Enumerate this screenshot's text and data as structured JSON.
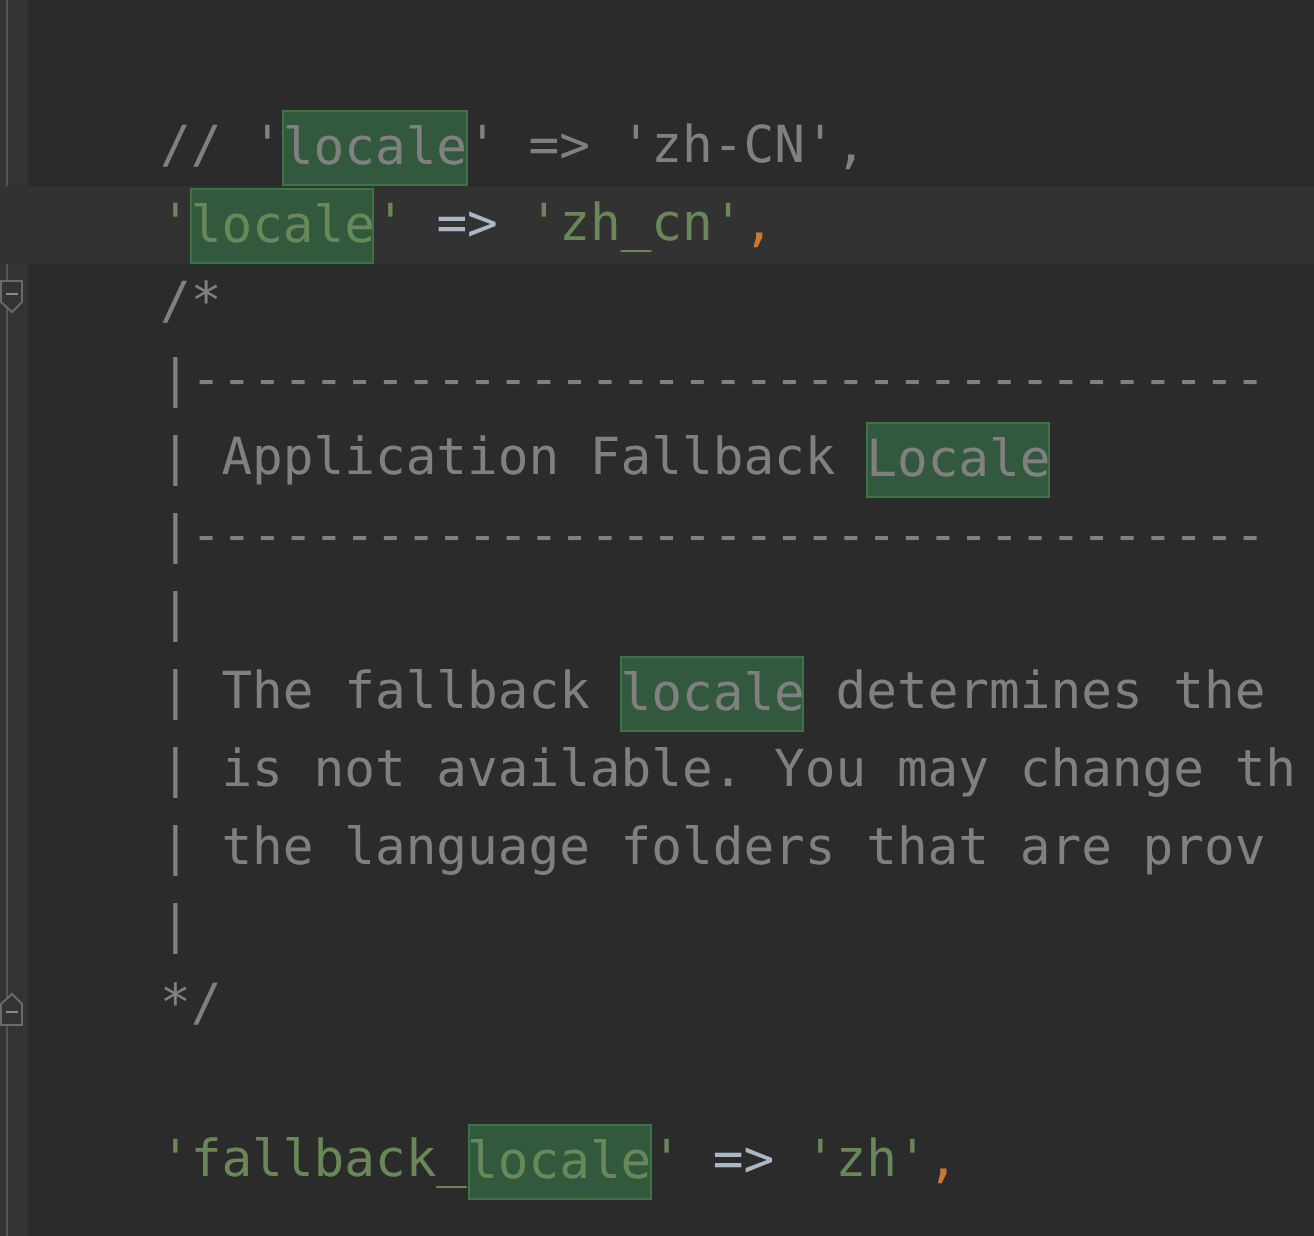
{
  "editor": {
    "lines": [
      {
        "kind": "blank",
        "current": false
      },
      {
        "kind": "code",
        "current": false,
        "tokens": [
          {
            "text": "// '",
            "kind": "comment",
            "match": false
          },
          {
            "text": "locale",
            "kind": "comment",
            "match": true
          },
          {
            "text": "' => 'zh-CN',",
            "kind": "comment",
            "match": false
          }
        ]
      },
      {
        "kind": "code",
        "current": true,
        "tokens": [
          {
            "text": "'",
            "kind": "string",
            "match": false
          },
          {
            "text": "locale",
            "kind": "string",
            "match": true
          },
          {
            "text": "'",
            "kind": "string",
            "match": false
          },
          {
            "text": " => ",
            "kind": "operator",
            "match": false
          },
          {
            "text": "'zh_cn'",
            "kind": "string",
            "match": false
          },
          {
            "text": ",",
            "kind": "punct",
            "match": false
          }
        ]
      },
      {
        "kind": "code",
        "current": false,
        "marker": {
          "kind": "fold_start"
        },
        "tokens": [
          {
            "text": "/*",
            "kind": "comment",
            "match": false
          }
        ]
      },
      {
        "kind": "code",
        "current": false,
        "tokens": [
          {
            "text": "|-----------------------------------",
            "kind": "comment",
            "match": false
          }
        ]
      },
      {
        "kind": "code",
        "current": false,
        "tokens": [
          {
            "text": "| Application Fallback ",
            "kind": "comment",
            "match": false
          },
          {
            "text": "Locale",
            "kind": "comment",
            "match": true
          }
        ]
      },
      {
        "kind": "code",
        "current": false,
        "tokens": [
          {
            "text": "|-----------------------------------",
            "kind": "comment",
            "match": false
          }
        ]
      },
      {
        "kind": "code",
        "current": false,
        "tokens": [
          {
            "text": "|",
            "kind": "comment",
            "match": false
          }
        ]
      },
      {
        "kind": "code",
        "current": false,
        "tokens": [
          {
            "text": "| The fallback ",
            "kind": "comment",
            "match": false
          },
          {
            "text": "locale",
            "kind": "comment",
            "match": true
          },
          {
            "text": " determines the",
            "kind": "comment",
            "match": false
          }
        ]
      },
      {
        "kind": "code",
        "current": false,
        "tokens": [
          {
            "text": "| is not available. You may change th",
            "kind": "comment",
            "match": false
          }
        ]
      },
      {
        "kind": "code",
        "current": false,
        "tokens": [
          {
            "text": "| the language folders that are prov",
            "kind": "comment",
            "match": false
          }
        ]
      },
      {
        "kind": "code",
        "current": false,
        "tokens": [
          {
            "text": "|",
            "kind": "comment",
            "match": false
          }
        ]
      },
      {
        "kind": "code",
        "current": false,
        "marker": {
          "kind": "fold_end"
        },
        "tokens": [
          {
            "text": "*/",
            "kind": "comment",
            "match": false
          }
        ]
      },
      {
        "kind": "blank",
        "current": false
      },
      {
        "kind": "code",
        "current": false,
        "tokens": [
          {
            "text": "'fallback_",
            "kind": "string",
            "match": false
          },
          {
            "text": "locale",
            "kind": "string",
            "match": true
          },
          {
            "text": "'",
            "kind": "string",
            "match": false
          },
          {
            "text": " => ",
            "kind": "operator",
            "match": false
          },
          {
            "text": "'zh'",
            "kind": "string",
            "match": false
          },
          {
            "text": ",",
            "kind": "punct",
            "match": false
          }
        ]
      }
    ]
  }
}
